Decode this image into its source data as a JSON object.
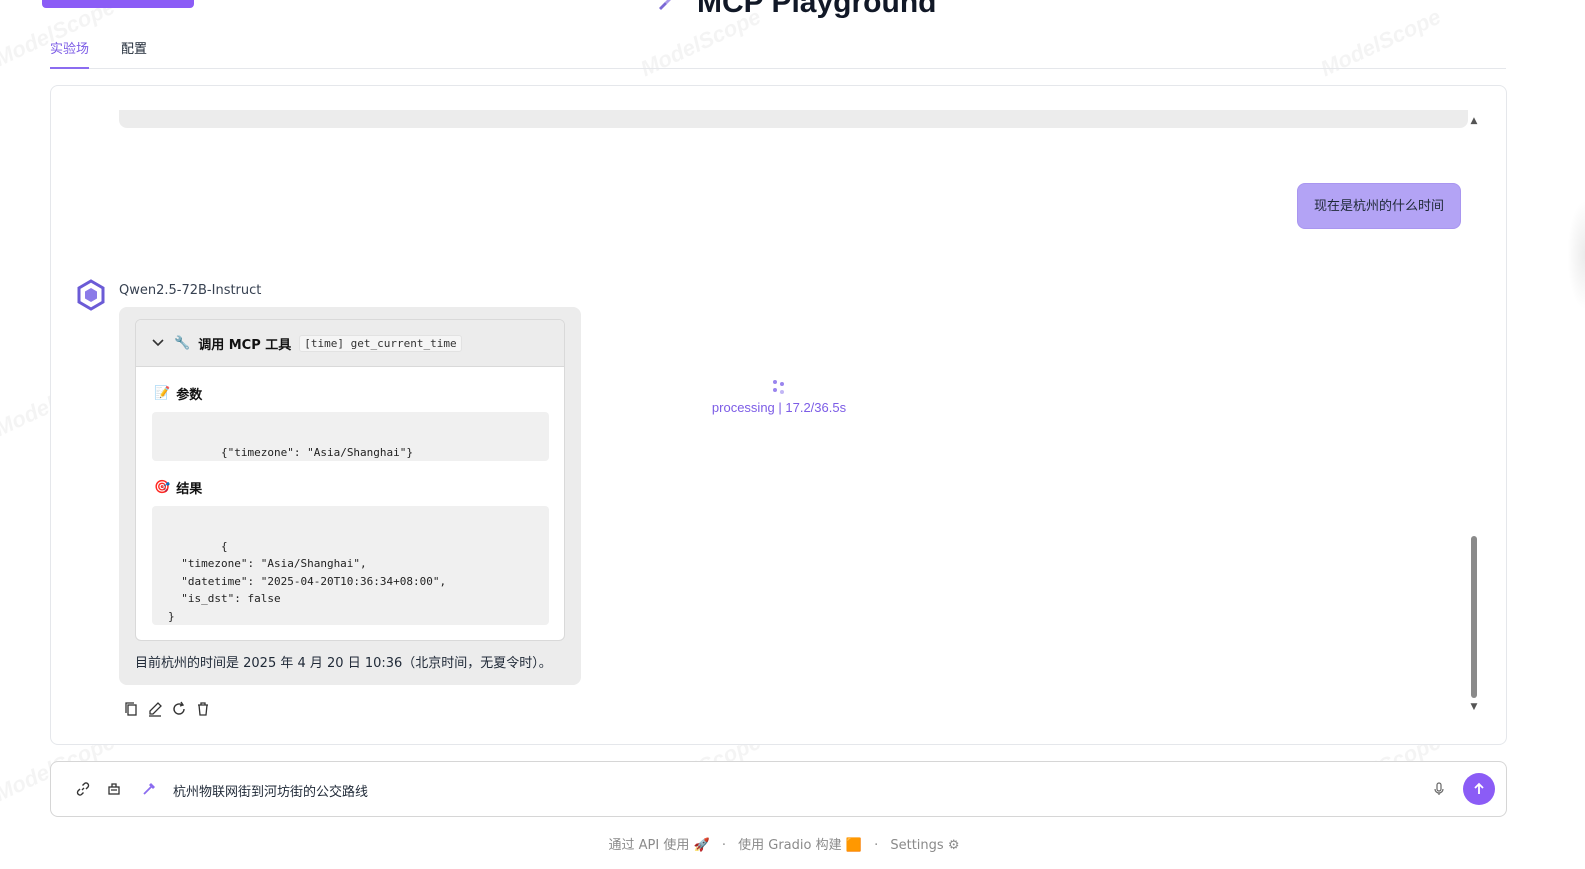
{
  "header": {
    "title": "MCP Playground"
  },
  "tabs": [
    {
      "label": "实验场",
      "active": true
    },
    {
      "label": "配置",
      "active": false
    }
  ],
  "chat": {
    "user_message": "现在是杭州的什么时间",
    "bot_name": "Qwen2.5-72B-Instruct",
    "tool_call": {
      "title": "调用 MCP 工具",
      "tool_tag": "[time] get_current_time",
      "params_label": "参数",
      "params_code": "{\"timezone\": \"Asia/Shanghai\"}",
      "result_label": "结果",
      "result_code": "{\n  \"timezone\": \"Asia/Shanghai\",\n  \"datetime\": \"2025-04-20T10:36:34+08:00\",\n  \"is_dst\": false\n}"
    },
    "answer": "目前杭州的时间是 2025 年 4 月 20 日 10:36（北京时间，无夏令时）。",
    "processing": "processing | 17.2/36.5s"
  },
  "input": {
    "value": "杭州物联网街到河坊街的公交路线"
  },
  "footer": {
    "api": "通过 API 使用",
    "gradio": "使用 Gradio 构建",
    "settings": "Settings"
  },
  "watermark": "ModelScope",
  "colors": {
    "accent": "#8b5cf6",
    "user_bubble": "#b3a3f5",
    "bot_bubble": "#ececec"
  }
}
